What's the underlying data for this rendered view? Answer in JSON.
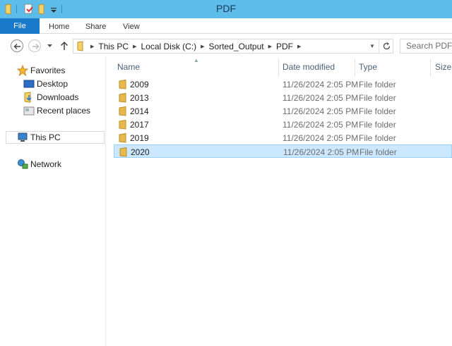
{
  "window": {
    "title": "PDF"
  },
  "ribbon": {
    "tabs": [
      {
        "label": "File"
      },
      {
        "label": "Home"
      },
      {
        "label": "Share"
      },
      {
        "label": "View"
      }
    ]
  },
  "address": {
    "crumbs": [
      "This PC",
      "Local Disk (C:)",
      "Sorted_Output",
      "PDF"
    ]
  },
  "search": {
    "placeholder": "Search PDF"
  },
  "nav": {
    "favorites": "Favorites",
    "desktop": "Desktop",
    "downloads": "Downloads",
    "recent": "Recent places",
    "thispc": "This PC",
    "network": "Network"
  },
  "columns": {
    "name": "Name",
    "date": "Date modified",
    "type": "Type",
    "size": "Size"
  },
  "files": [
    {
      "name": "2009",
      "date": "11/26/2024 2:05 PM",
      "type": "File folder"
    },
    {
      "name": "2013",
      "date": "11/26/2024 2:05 PM",
      "type": "File folder"
    },
    {
      "name": "2014",
      "date": "11/26/2024 2:05 PM",
      "type": "File folder"
    },
    {
      "name": "2017",
      "date": "11/26/2024 2:05 PM",
      "type": "File folder"
    },
    {
      "name": "2019",
      "date": "11/26/2024 2:05 PM",
      "type": "File folder"
    },
    {
      "name": "2020",
      "date": "11/26/2024 2:05 PM",
      "type": "File folder",
      "selected": true
    }
  ],
  "colors": {
    "titlebar": "#5ebcea",
    "file_tab": "#1979ca",
    "selection": "#cce8ff",
    "folder": "#e8b84a"
  }
}
